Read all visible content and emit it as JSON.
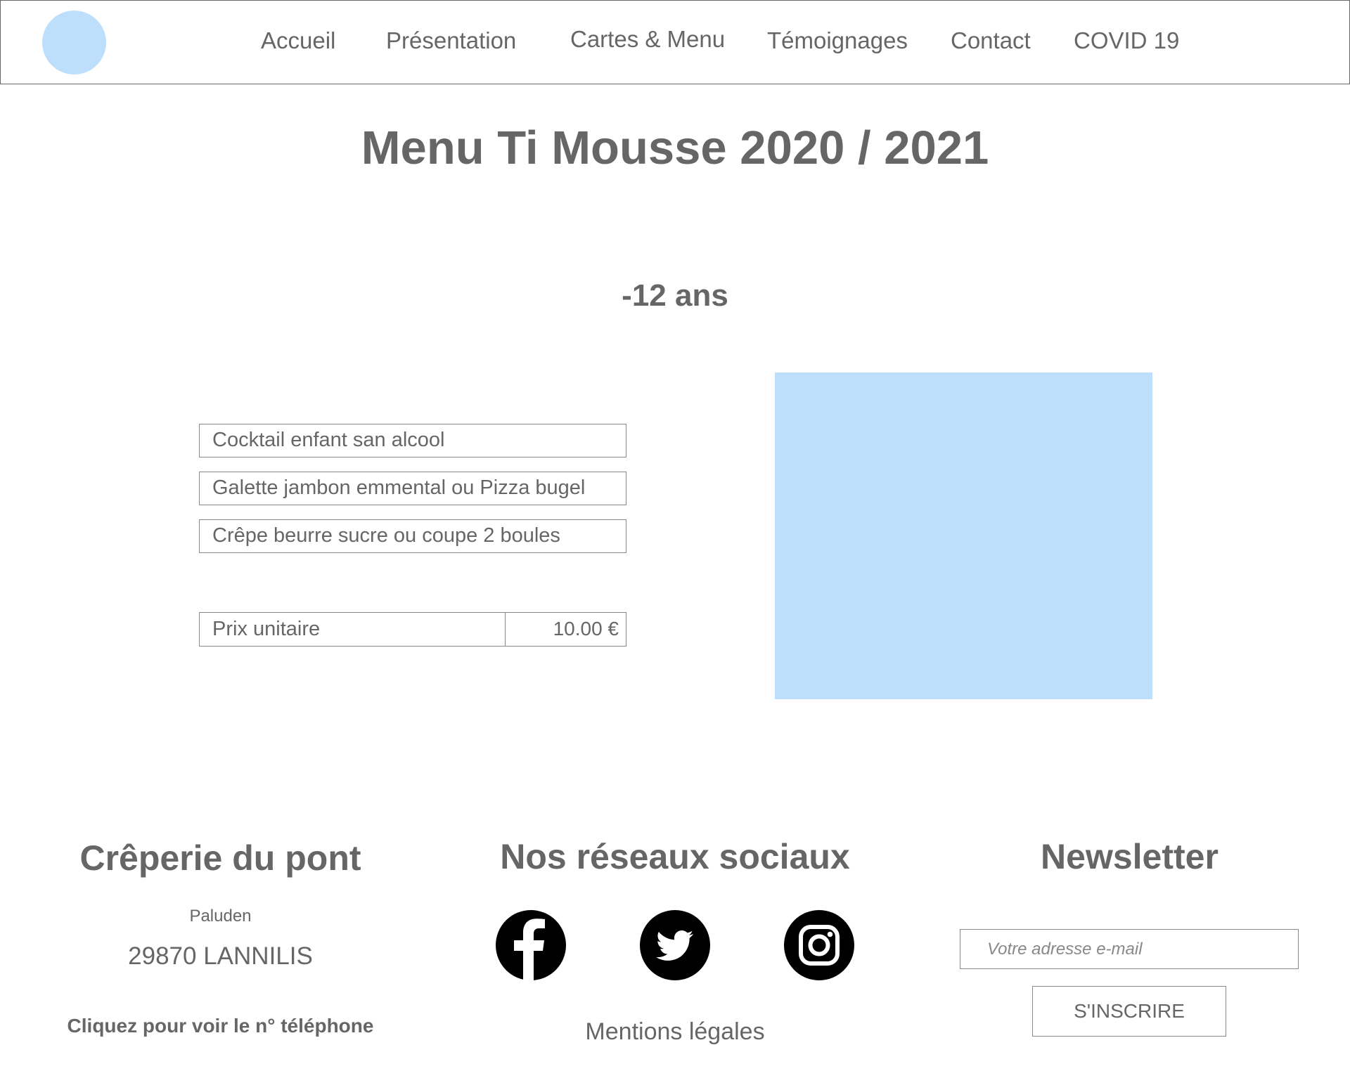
{
  "header": {
    "nav": [
      {
        "label": "Accueil"
      },
      {
        "label": "Présentation"
      },
      {
        "label": "Cartes & Menu"
      },
      {
        "label": "Témoignages"
      },
      {
        "label": "Contact"
      },
      {
        "label": "COVID 19"
      }
    ]
  },
  "main": {
    "title": "Menu Ti Mousse 2020 / 2021",
    "section_title": "-12 ans",
    "items": [
      {
        "label": "Cocktail enfant san alcool"
      },
      {
        "label": "Galette jambon emmental ou Pizza bugel"
      },
      {
        "label": "Crêpe beurre sucre ou coupe 2 boules"
      }
    ],
    "price": {
      "label": "Prix unitaire",
      "value": "10.00 €"
    }
  },
  "footer": {
    "company": {
      "heading": "Crêperie du pont",
      "locality": "Paluden",
      "city": "29870 LANNILIS",
      "phone_link": "Cliquez pour voir le n° téléphone"
    },
    "social": {
      "heading": "Nos réseaux sociaux",
      "icons": [
        "facebook-icon",
        "twitter-icon",
        "instagram-icon"
      ],
      "legal_link": "Mentions légales"
    },
    "newsletter": {
      "heading": "Newsletter",
      "email_placeholder": "Votre adresse e-mail",
      "button_label": "S'INSCRIRE"
    }
  },
  "colors": {
    "text": "#666666",
    "placeholder_fill": "#bddffc",
    "border": "#888888"
  }
}
